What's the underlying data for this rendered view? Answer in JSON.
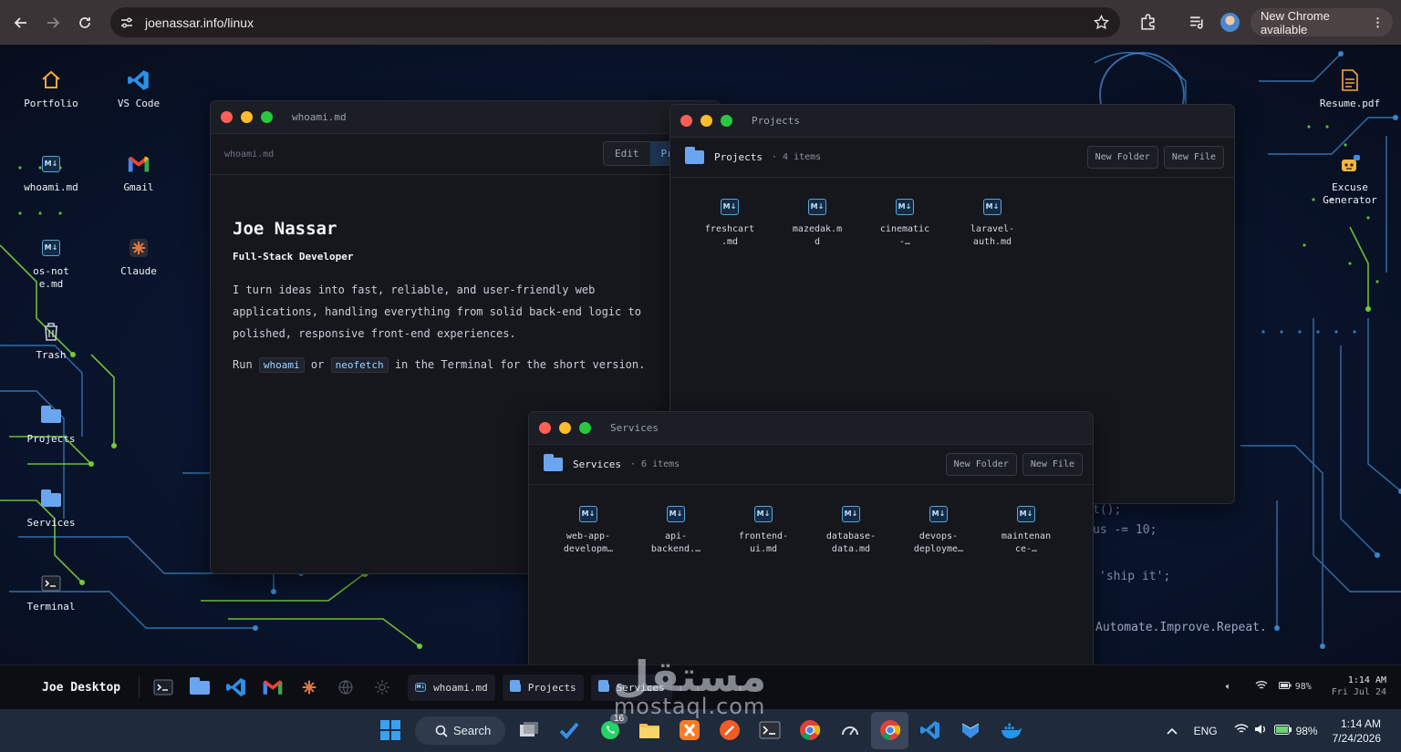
{
  "browser": {
    "url": "joenassar.info/linux",
    "update_label": "New Chrome available"
  },
  "desktop": {
    "icons": [
      {
        "label": "Portfolio",
        "icon": "home-icon"
      },
      {
        "label": "VS Code",
        "icon": "vscode-icon"
      },
      {
        "label": "whoami.md",
        "icon": "markdown-icon"
      },
      {
        "label": "Gmail",
        "icon": "gmail-icon"
      },
      {
        "label": "os-note.md",
        "icon": "markdown-icon"
      },
      {
        "label": "Claude",
        "icon": "claude-icon"
      },
      {
        "label": "Trash",
        "icon": "trash-icon"
      },
      {
        "label": "Projects",
        "icon": "folder-icon"
      },
      {
        "label": "Services",
        "icon": "folder-icon"
      },
      {
        "label": "Terminal",
        "icon": "terminal-icon"
      },
      {
        "label": "Resume.pdf",
        "icon": "pdf-icon"
      },
      {
        "label": "Excuse Generator",
        "icon": "bot-icon"
      }
    ],
    "background_code": [
      "t();",
      "us -= 10;",
      "'ship it';",
      "Automate.Improve.Repeat."
    ]
  },
  "whoami_window": {
    "title": "whoami.md",
    "filename": "whoami.md",
    "mode_edit": "Edit",
    "mode_preview": "Pre",
    "heading": "Joe Nassar",
    "subheading": "Full-Stack Developer",
    "paragraph": "I turn ideas into fast, reliable, and user-friendly web applications, handling everything from solid back-end logic to polished, responsive front-end experiences.",
    "run_prefix": "Run",
    "cmd1": "whoami",
    "run_or": "or",
    "cmd2": "neofetch",
    "run_suffix": "in the Terminal for the short version."
  },
  "projects_window": {
    "title": "Projects",
    "folder_name": "Projects",
    "count": "· 4 items",
    "new_folder": "New Folder",
    "new_file": "New File",
    "files": [
      "freshcart\n.md",
      "mazedak.m\nd",
      "cinematic\n-…",
      "laravel-\nauth.md"
    ]
  },
  "services_window": {
    "title": "Services",
    "folder_name": "Services",
    "count": "· 6 items",
    "new_folder": "New Folder",
    "new_file": "New File",
    "files": [
      "web-app-\ndevelopm…",
      "api-\nbackend.…",
      "frontend-\nui.md",
      "database-\ndata.md",
      "devops-\ndeployme…",
      "maintenan\nce-…"
    ]
  },
  "dock": {
    "title": "Joe Desktop",
    "windows": [
      "whoami.md",
      "Projects",
      "Services"
    ],
    "battery": "98%",
    "time": "1:14 AM",
    "date": "Fri Jul 24"
  },
  "taskbar": {
    "search_label": "Search",
    "whatsapp_badge": "16",
    "language": "ENG",
    "battery": "98%",
    "time": "1:14 AM",
    "date": "7/24/2026"
  },
  "watermark": {
    "arabic": "مستقل",
    "latin": "mostaql.com"
  },
  "colors": {
    "accent_blue": "#6aa6f0",
    "close": "#fe5f57",
    "minimize": "#febc2e",
    "maximize": "#28c840",
    "circuit_green": "#7bdc3a"
  }
}
